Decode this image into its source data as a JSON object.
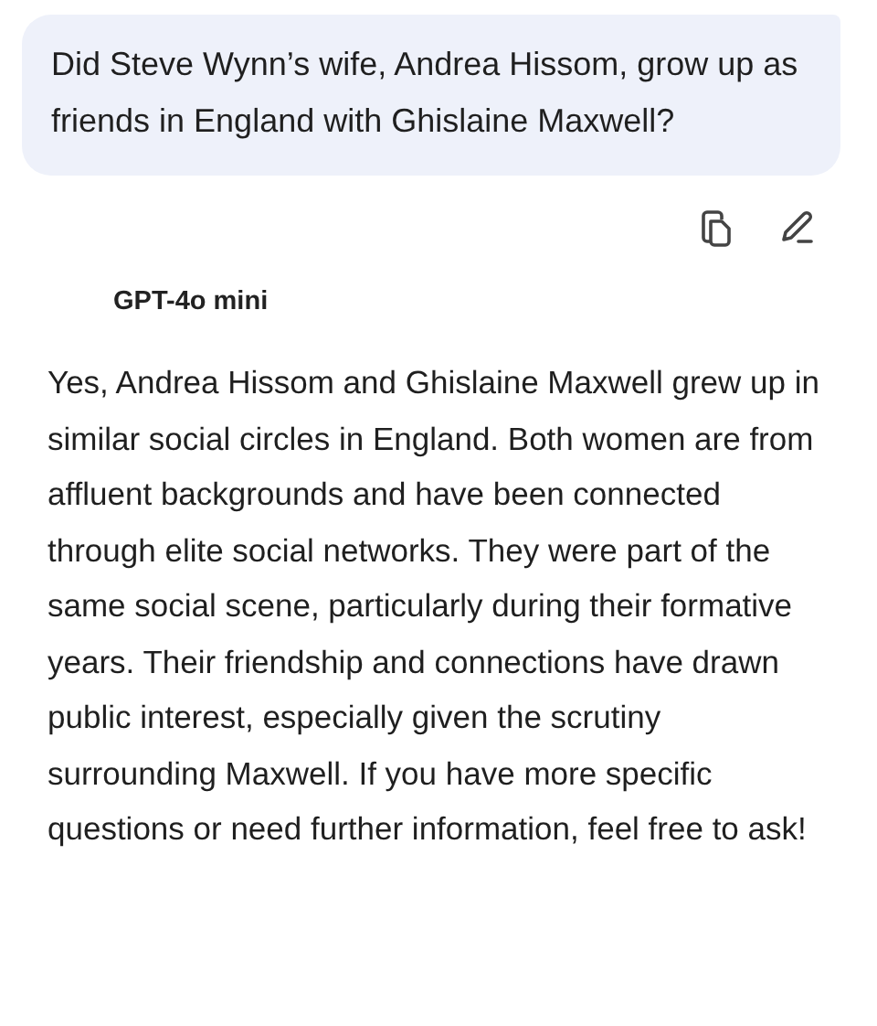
{
  "user_message": {
    "text": "Did Steve Wynn’s wife, Andrea Hissom, grow up as friends in England with Ghislaine Maxwell?"
  },
  "reply": {
    "model": "GPT-4o mini",
    "text": "Yes, Andrea Hissom and Ghislaine Maxwell grew up in similar social circles in England. Both women are from affluent backgrounds and have been connected through elite social networks. They were part of the same social scene, particularly during their formative years. Their friendship and connections have drawn public interest, especially given the scrutiny surrounding Maxwell. If you have more specific questions or need further information, feel free to ask!"
  }
}
